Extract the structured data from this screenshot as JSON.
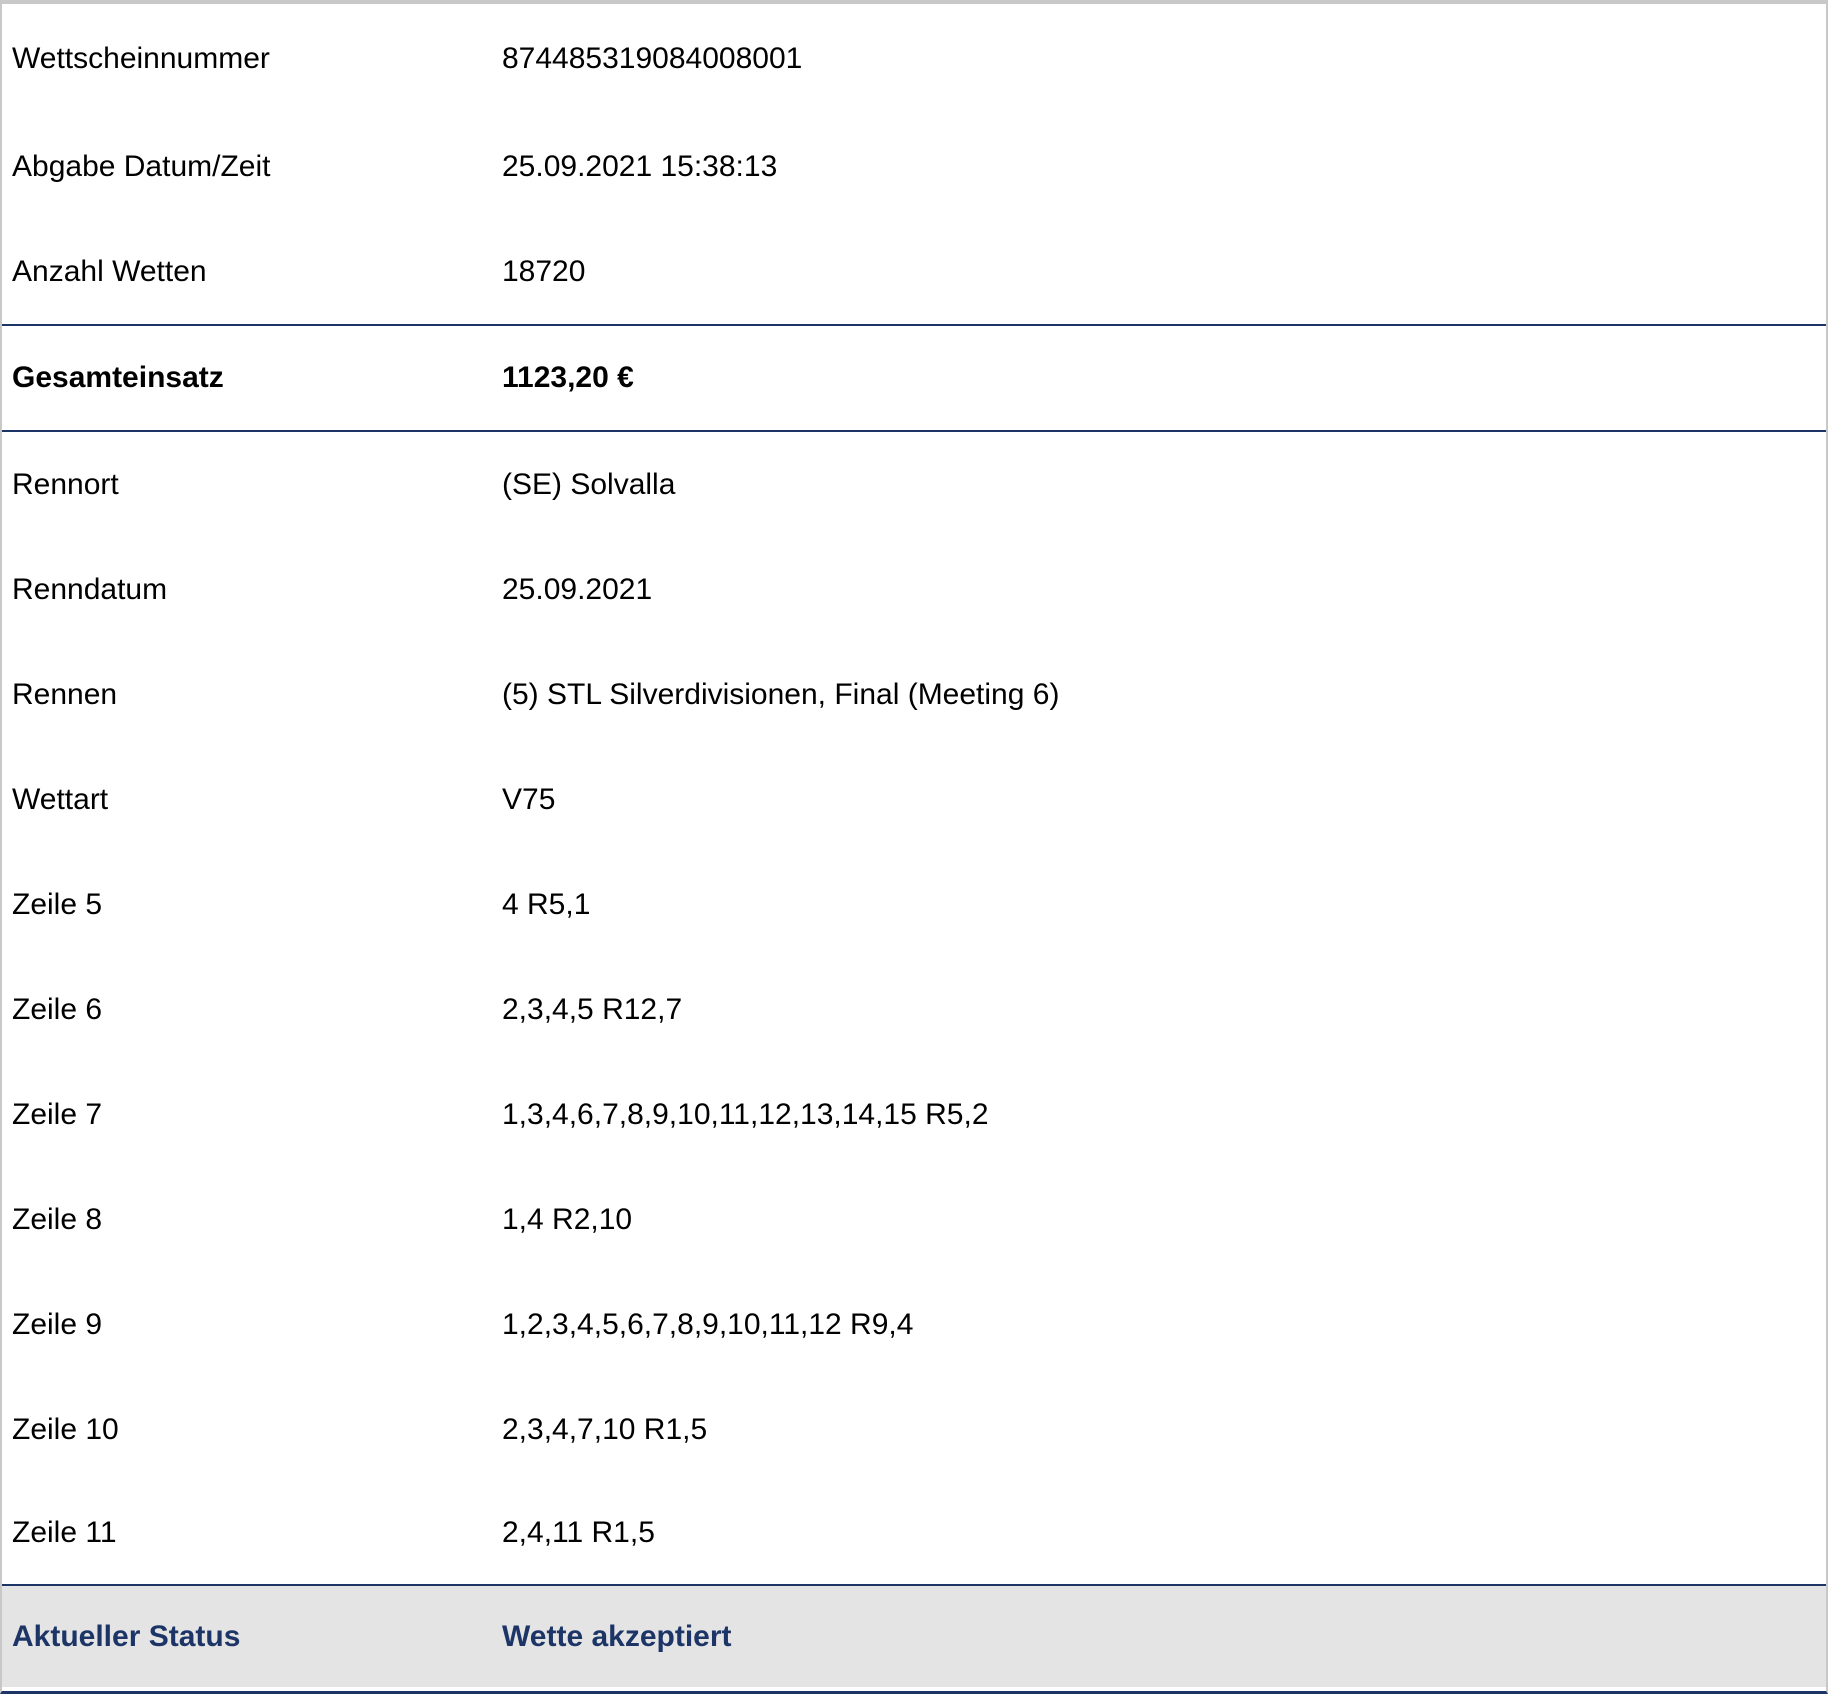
{
  "ticket": {
    "header_rows": [
      {
        "label": "Wettscheinnummer",
        "value": "874485319084008001"
      },
      {
        "label": "Abgabe Datum/Zeit",
        "value": "25.09.2021 15:38:13"
      },
      {
        "label": "Anzahl Wetten",
        "value": "18720"
      }
    ],
    "total": {
      "label": "Gesamteinsatz",
      "value": "1123,20 €"
    },
    "detail_rows": [
      {
        "label": "Rennort",
        "value": "(SE) Solvalla"
      },
      {
        "label": "Renndatum",
        "value": "25.09.2021"
      },
      {
        "label": "Rennen",
        "value": "(5) STL Silverdivisionen, Final (Meeting 6)"
      },
      {
        "label": "Wettart",
        "value": "V75"
      },
      {
        "label": "Zeile 5",
        "value": "4 R5,1"
      },
      {
        "label": "Zeile 6",
        "value": "2,3,4,5 R12,7"
      },
      {
        "label": "Zeile 7",
        "value": "1,3,4,6,7,8,9,10,11,12,13,14,15 R5,2"
      },
      {
        "label": "Zeile 8",
        "value": "1,4 R2,10"
      },
      {
        "label": "Zeile 9",
        "value": "1,2,3,4,5,6,7,8,9,10,11,12 R9,4"
      },
      {
        "label": "Zeile 10",
        "value": "2,3,4,7,10 R1,5"
      },
      {
        "label": "Zeile 11",
        "value": "2,4,11 R1,5"
      }
    ],
    "status": {
      "label": "Aktueller Status",
      "value": "Wette akzeptiert"
    }
  },
  "colors": {
    "accent": "#1c3566",
    "status_background": "#e4e4e4",
    "outer_border": "#c8c8c8"
  }
}
